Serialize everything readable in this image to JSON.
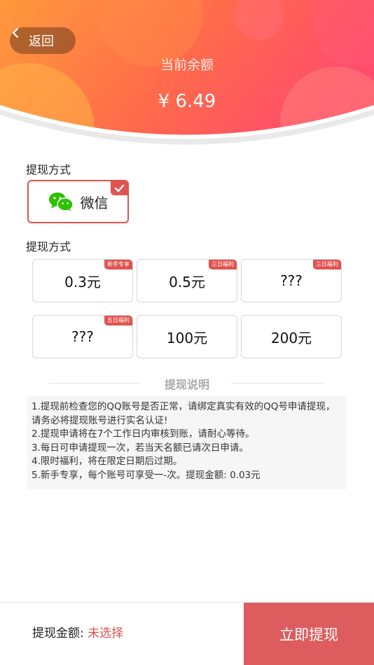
{
  "header": {
    "back_label": "返回",
    "balance_label": "当前余额",
    "balance_value": "¥ 6.49",
    "gradient_start": "#ff9a3c",
    "gradient_end": "#ff4d6d"
  },
  "payment_section": {
    "title": "提现方式",
    "methods": [
      {
        "label": "微信",
        "icon": "wechat-icon",
        "selected": true
      }
    ]
  },
  "amount_section": {
    "title": "提现方式",
    "options": [
      {
        "label": "0.3元",
        "tag": "新手专享"
      },
      {
        "label": "0.5元",
        "tag": "三日福利"
      },
      {
        "label": "???",
        "tag": "三日福利"
      },
      {
        "label": "???",
        "tag": "五日福利"
      },
      {
        "label": "100元",
        "tag": ""
      },
      {
        "label": "200元",
        "tag": ""
      }
    ]
  },
  "notes": {
    "title": "提现说明",
    "lines": [
      "1.提现前检查您的QQ账号是否正常，请绑定真实有效的QQ号申请提现，请务必将提现账号进行实名认证!",
      "2.提现申请将在7个工作日内审核到账，请耐心等待。",
      "3.每日可申请提现一次，若当天名额已请次日申请。",
      "4.限时福利，将在限定日期后过期。",
      "5.新手专享，每个账号可享受一-次。提现金额: 0.03元"
    ]
  },
  "footer": {
    "amount_label": "提现金额:",
    "amount_value": "未选择",
    "submit_label": "立即提现",
    "accent": "#dd5d5e"
  }
}
